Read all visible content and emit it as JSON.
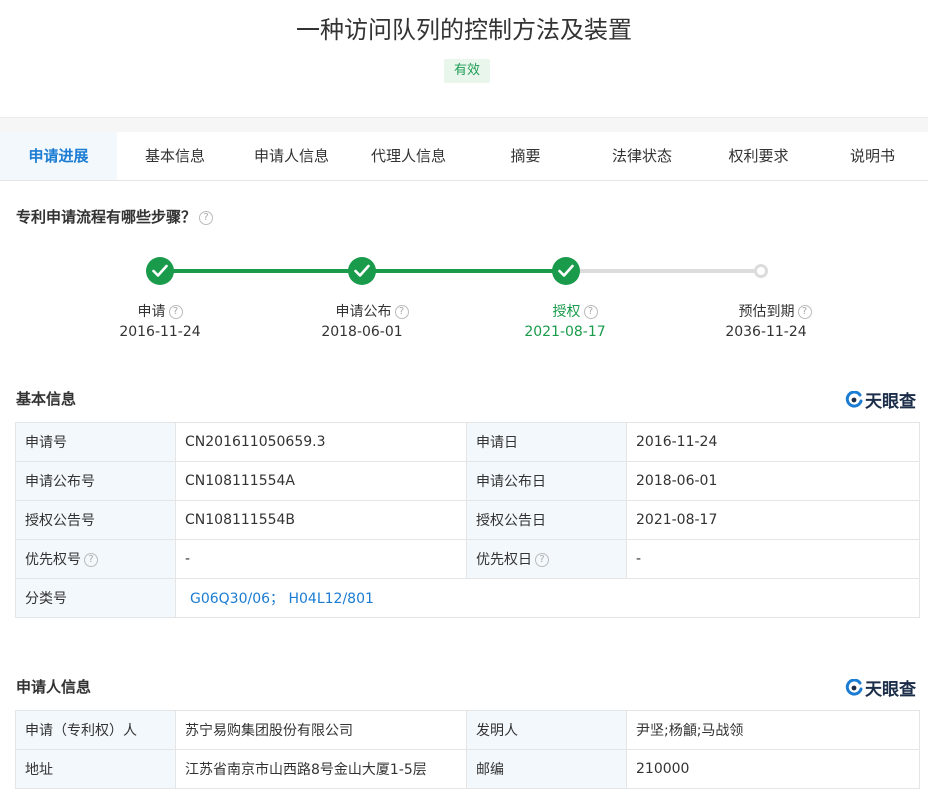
{
  "header": {
    "title": "一种访问队列的控制方法及装置",
    "status": "有效"
  },
  "tabs": [
    {
      "label": "申请进展",
      "active": true
    },
    {
      "label": "基本信息"
    },
    {
      "label": "申请人信息"
    },
    {
      "label": "代理人信息"
    },
    {
      "label": "摘要"
    },
    {
      "label": "法律状态"
    },
    {
      "label": "权利要求"
    },
    {
      "label": "说明书"
    }
  ],
  "progress": {
    "title": "专利申请流程有哪些步骤？",
    "help_icon": "?",
    "steps": [
      {
        "label": "申请",
        "date": "2016-11-24",
        "status": "done"
      },
      {
        "label": "申请公布",
        "date": "2018-06-01",
        "status": "done"
      },
      {
        "label": "授权",
        "date": "2021-08-17",
        "status": "current"
      },
      {
        "label": "预估到期",
        "date": "2036-11-24",
        "status": "pending"
      }
    ]
  },
  "brand": {
    "name": "天眼查",
    "icon": "tianyancha-logo-icon"
  },
  "basic_info": {
    "title": "基本信息",
    "rows": [
      {
        "k1": "申请号",
        "v1": "CN201611050659.3",
        "k2": "申请日",
        "v2": "2016-11-24"
      },
      {
        "k1": "申请公布号",
        "v1": "CN108111554A",
        "k2": "申请公布日",
        "v2": "2018-06-01"
      },
      {
        "k1": "授权公告号",
        "v1": "CN108111554B",
        "k2": "授权公告日",
        "v2": "2021-08-17"
      },
      {
        "k1": "优先权号",
        "v1": "-",
        "k2": "优先权日",
        "v2": "-"
      }
    ],
    "classification": {
      "label": "分类号",
      "codes": [
        "G06Q30/06",
        "H04L12/801"
      ],
      "separator": "；"
    }
  },
  "applicant_info": {
    "title": "申请人信息",
    "applicant_label": "申请（专利权）人",
    "applicant": "苏宁易购集团股份有限公司",
    "inventor_label": "发明人",
    "inventors": "尹坚;杨龥;马战领",
    "address_label": "地址",
    "address": "江苏省南京市山西路8号金山大厦1-5层",
    "zip_label": "邮编",
    "zip": "210000"
  },
  "colors": {
    "accent": "#1b7cd3",
    "success": "#1a9b4b",
    "key_bg": "#f3f8fd"
  }
}
